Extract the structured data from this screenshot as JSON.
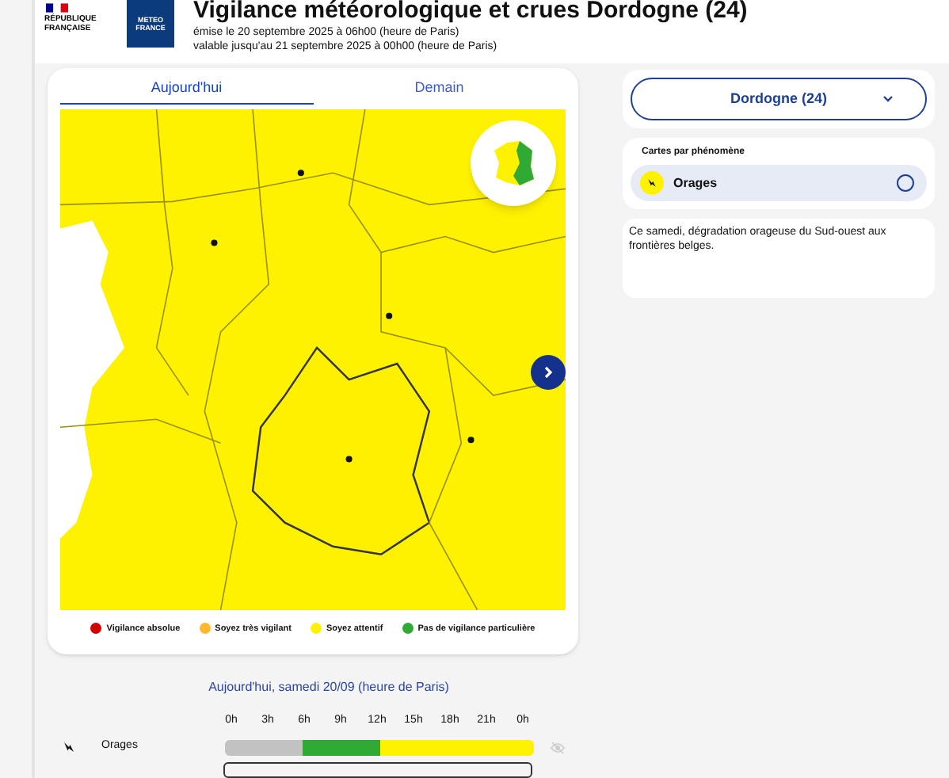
{
  "header": {
    "republic": "RÉPUBLIQUE\nFRANÇAISE",
    "logo_text": "METEO\nFRANCE",
    "title": "Vigilance météorologique et crues Dordogne (24)",
    "issued": "émise le 20 septembre 2025 à 06h00 (heure de Paris)",
    "valid": "valable jusqu'au 21 septembre 2025 à 00h00 (heure de Paris)"
  },
  "tabs": [
    {
      "label": "Aujourd'hui",
      "selected": true
    },
    {
      "label": "Demain",
      "selected": false
    }
  ],
  "legend": [
    {
      "label": "Vigilance absolue",
      "color": "#d40000"
    },
    {
      "label": "Soyez très vigilant",
      "color": "#ffb82b"
    },
    {
      "label": "Soyez attentif",
      "color": "#fff200"
    },
    {
      "label": "Pas de vigilance particulière",
      "color": "#31aa35"
    }
  ],
  "department_select": {
    "value": "Dordogne (24)"
  },
  "phenomena": {
    "title": "Cartes par phénomène",
    "items": [
      {
        "label": "Orages",
        "selected": false
      }
    ]
  },
  "bulletin": "Ce samedi, dégradation orageuse du Sud-ouest aux frontières belges.",
  "timeline": {
    "title": "Aujourd'hui, samedi 20/09 (heure de Paris)",
    "hours": [
      "0h",
      "3h",
      "6h",
      "9h",
      "12h",
      "15h",
      "18h",
      "21h",
      "0h"
    ],
    "rows": [
      {
        "label": "Orages",
        "slots": [
          {
            "color": "#c2c2c2"
          },
          {
            "color": "#c2c2c2"
          },
          {
            "color": "#31aa35"
          },
          {
            "color": "#31aa35"
          },
          {
            "color": "#fff200"
          },
          {
            "color": "#fff200"
          },
          {
            "color": "#fff200"
          },
          {
            "color": "#fff200"
          }
        ]
      }
    ]
  }
}
